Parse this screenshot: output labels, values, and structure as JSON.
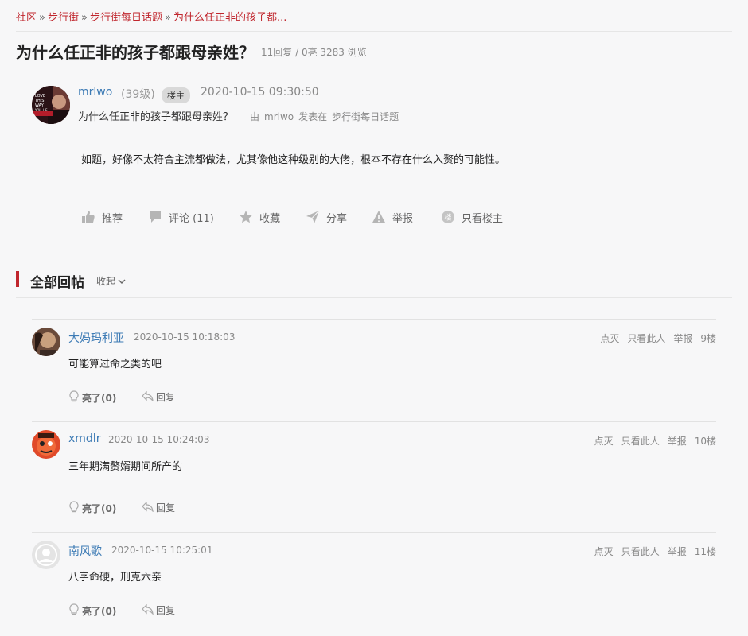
{
  "breadcrumb": {
    "items": [
      "社区",
      "步行街",
      "步行街每日话题",
      "为什么任正非的孩子都..."
    ],
    "separator": "»"
  },
  "thread": {
    "title": "为什么任正非的孩子都跟母亲姓？",
    "meta": "11回复 / 0亮 3283 浏览"
  },
  "op": {
    "name": "mrlwo",
    "level": "(39级)",
    "badge": "楼主",
    "time": "2020-10-15 09:30:50",
    "subject": "为什么任正非的孩子都跟母亲姓？",
    "meta_by": "由",
    "meta_user": "mrlwo",
    "meta_posted": "发表在",
    "meta_board": "步行街每日话题",
    "body": "如题，好像不太符合主流都做法，尤其像他这种级别的大佬，根本不存在什么入赘的可能性。",
    "avatar_text": [
      "LOVE",
      "THIS",
      "WAY",
      "YOU LIE"
    ]
  },
  "actions": {
    "recommend": "推荐",
    "comment": "评论 (11)",
    "favorite": "收藏",
    "share": "分享",
    "report": "举报",
    "op_only": "只看楼主",
    "op_only_icon_char": "楼"
  },
  "section": {
    "title": "全部回帖",
    "collapse": "收起"
  },
  "replies": [
    {
      "name": "大妈玛利亚",
      "time": "2020-10-15 10:18:03",
      "body": "可能算过命之类的吧",
      "dim": "点灭",
      "only": "只看此人",
      "report": "举报",
      "floor": "9楼",
      "light": "亮了(0)",
      "reply": "回复"
    },
    {
      "name": "xmdlr",
      "time": "2020-10-15 10:24:03",
      "body": "三年期满赘婿期间所产的",
      "dim": "点灭",
      "only": "只看此人",
      "report": "举报",
      "floor": "10楼",
      "light": "亮了(0)",
      "reply": "回复"
    },
    {
      "name": "南风歌",
      "time": "2020-10-15 10:25:01",
      "body": "八字命硬，刑克六亲",
      "dim": "点灭",
      "only": "只看此人",
      "report": "举报",
      "floor": "11楼",
      "light": "亮了(0)",
      "reply": "回复"
    }
  ],
  "colors": {
    "accent": "#c0262d",
    "link": "#3d7bb5",
    "muted": "#888888",
    "background": "#f7f7f8"
  }
}
